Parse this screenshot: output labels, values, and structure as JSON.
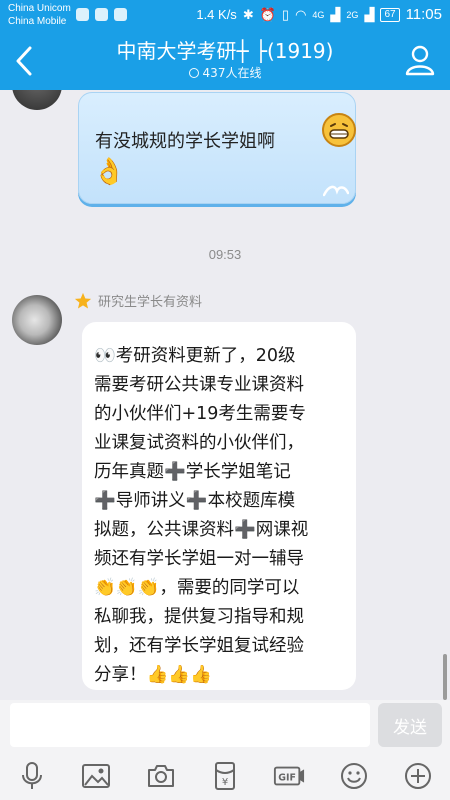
{
  "status_bar": {
    "carrier_1": "China Unicom",
    "carrier_2": "China Mobile",
    "speed": "1.4 K/s",
    "signal_1": "4G",
    "signal_2": "2G",
    "battery": "67",
    "time": "11:05"
  },
  "header": {
    "title": "中南大学考研┼ ├(1919)",
    "online": "437人在线"
  },
  "messages": {
    "first": {
      "text": "有没城规的学长学姐啊"
    },
    "time_separator": "09:53",
    "second": {
      "sender": "研究生学长有资料",
      "lines": [
        "👀考研资料更新了，20级",
        "需要考研公共课专业课资料",
        "的小伙伴们+19考生需要专",
        "业课复试资料的小伙伴们，",
        "历年真题➕学长学姐笔记",
        "➕导师讲义➕本校题库模",
        "拟题，公共课资料➕网课视",
        "频还有学长学姐一对一辅导",
        "👏👏👏，需要的同学可以",
        "私聊我，提供复习指导和规",
        "划，还有学长学姐复试经验",
        "分享！👍👍👍"
      ]
    }
  },
  "input": {
    "value": "",
    "send_label": "发送"
  },
  "toolbar_icons": [
    "microphone-icon",
    "image-icon",
    "camera-icon",
    "red-packet-icon",
    "gif-icon",
    "emoji-icon",
    "plus-icon"
  ],
  "colors": {
    "header_blue": "#1a9fe7",
    "bubble_blue": "#c3e2fb",
    "background": "#ececf1"
  }
}
